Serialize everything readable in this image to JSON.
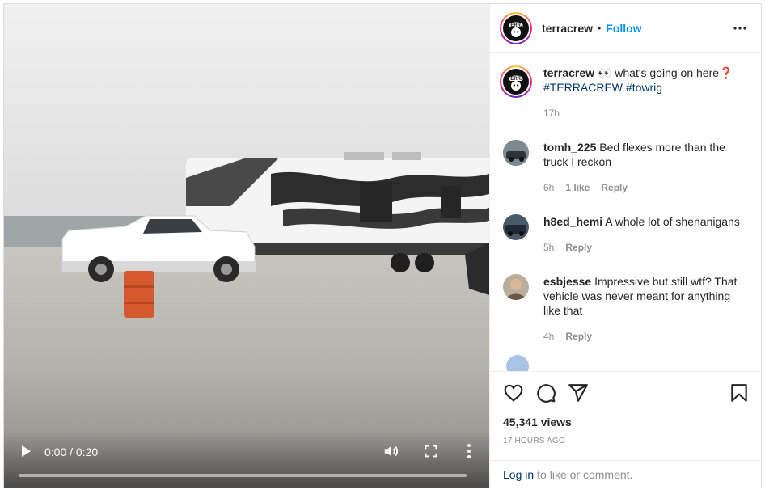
{
  "video": {
    "time_display": "0:00 / 0:20",
    "progress_fraction": 0.0,
    "buffered_fraction": 1.0
  },
  "header": {
    "username": "terracrew",
    "separator": "•",
    "follow_label": "Follow",
    "avatar_text": "TERRA"
  },
  "caption": {
    "username": "terracrew",
    "text": "👀 what's going on here❓",
    "hashtags": [
      "#TERRACREW",
      "#towrig"
    ],
    "age": "17h"
  },
  "comments": [
    {
      "username": "tomh_225",
      "text": "Bed flexes more than the truck I reckon",
      "age": "6h",
      "likes": "1 like",
      "reply": "Reply",
      "avatar_color": "#5d6b73"
    },
    {
      "username": "h8ed_hemi",
      "text": "A whole lot of shenanigans",
      "age": "5h",
      "likes": "",
      "reply": "Reply",
      "avatar_color": "#3b4a5c"
    },
    {
      "username": "esbjesse",
      "text": "Impressive but still wtf? That vehicle was never meant for anything like that",
      "age": "4h",
      "likes": "",
      "reply": "Reply",
      "avatar_color": "#8a7a6a"
    }
  ],
  "footer": {
    "views": "45,341 views",
    "posted": "17 HOURS AGO",
    "login_link": "Log in",
    "login_rest": "to like or comment."
  },
  "colors": {
    "link_blue": "#0095f6",
    "hashtag_blue": "#00376b",
    "muted": "#8e8e8e"
  },
  "icons": [
    "play-icon",
    "volume-icon",
    "fullscreen-icon",
    "more-vertical-icon",
    "more-horizontal-icon",
    "heart-icon",
    "comment-icon",
    "share-icon",
    "bookmark-icon"
  ]
}
